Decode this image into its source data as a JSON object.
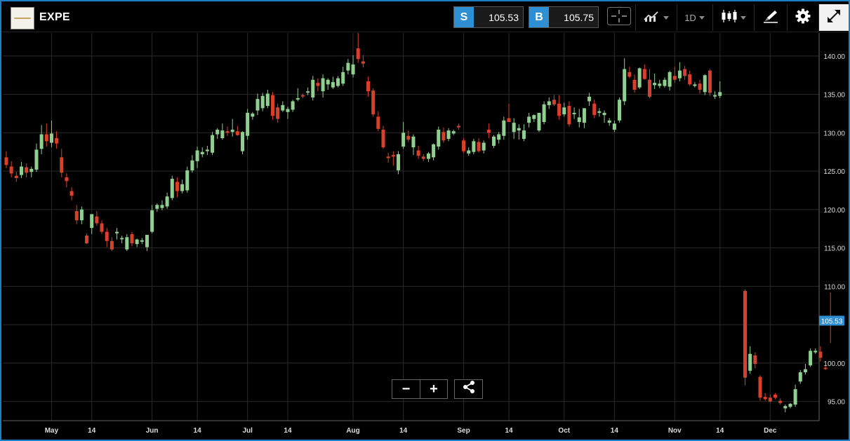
{
  "header": {
    "symbol": "EXPE",
    "sell_tag": "S",
    "sell_price": "105.53",
    "buy_tag": "B",
    "buy_price": "105.75",
    "timeframe": "1D"
  },
  "icons": [
    "logo-icon",
    "crosshair-icon",
    "indicators-icon",
    "candlestick-icon",
    "drawing-icon",
    "gear-icon",
    "fullscreen-icon",
    "zoom-out-icon",
    "zoom-in-icon",
    "share-icon"
  ],
  "colors": {
    "up": "#8fcf8f",
    "down": "#d9402b",
    "accent": "#2e8fd3",
    "grid": "#2a2a2a"
  },
  "chart_data": {
    "type": "candlestick",
    "ylim": [
      92.5,
      143
    ],
    "y_ticks": [
      95,
      100,
      105,
      110,
      115,
      120,
      125,
      130,
      135,
      140
    ],
    "y_tick_labels": [
      "95.00",
      "100.00",
      "",
      "110.00",
      "115.00",
      "120.00",
      "125.00",
      "130.00",
      "135.00",
      "140.00"
    ],
    "x_ticks": [
      {
        "label": "May",
        "index": 9
      },
      {
        "label": "14",
        "index": 17
      },
      {
        "label": "Jun",
        "index": 29
      },
      {
        "label": "14",
        "index": 38
      },
      {
        "label": "Jul",
        "index": 48
      },
      {
        "label": "14",
        "index": 56
      },
      {
        "label": "Aug",
        "index": 69
      },
      {
        "label": "14",
        "index": 79
      },
      {
        "label": "Sep",
        "index": 91
      },
      {
        "label": "14",
        "index": 100
      },
      {
        "label": "Oct",
        "index": 111
      },
      {
        "label": "14",
        "index": 121
      },
      {
        "label": "Nov",
        "index": 133
      },
      {
        "label": "14",
        "index": 142
      },
      {
        "label": "Dec",
        "index": 152
      }
    ],
    "last_price": 105.53,
    "last_price_label": "105.53",
    "ohlc": [
      [
        126.8,
        127.6,
        125.4,
        125.8
      ],
      [
        125.6,
        126.3,
        124.2,
        124.7
      ],
      [
        124.4,
        124.9,
        123.6,
        124.1
      ],
      [
        124.5,
        126.2,
        124.1,
        125.6
      ],
      [
        125.5,
        126.0,
        124.2,
        124.8
      ],
      [
        124.9,
        125.6,
        124.2,
        125.3
      ],
      [
        125.2,
        128.6,
        124.9,
        127.8
      ],
      [
        127.9,
        131.0,
        127.2,
        129.8
      ],
      [
        129.8,
        131.2,
        128.2,
        128.9
      ],
      [
        128.7,
        131.6,
        128.1,
        129.9
      ],
      [
        129.3,
        130.2,
        127.9,
        128.6
      ],
      [
        126.8,
        127.9,
        124.2,
        124.8
      ],
      [
        124.2,
        124.7,
        122.9,
        123.7
      ],
      [
        122.4,
        122.9,
        121.2,
        121.8
      ],
      [
        119.8,
        120.6,
        118.1,
        118.6
      ],
      [
        118.6,
        120.4,
        118.1,
        120.0
      ],
      [
        116.6,
        116.9,
        115.5,
        115.6
      ],
      [
        117.6,
        119.3,
        116.8,
        119.4
      ],
      [
        119.1,
        119.8,
        117.9,
        118.2
      ],
      [
        118.2,
        118.6,
        116.8,
        117.1
      ],
      [
        117.1,
        117.6,
        115.1,
        115.9
      ],
      [
        115.9,
        116.4,
        114.6,
        114.8
      ],
      [
        116.9,
        117.6,
        116.1,
        117.1
      ],
      [
        116.2,
        116.6,
        115.6,
        116.3
      ],
      [
        114.8,
        116.8,
        114.6,
        116.4
      ],
      [
        116.8,
        117.1,
        115.2,
        115.6
      ],
      [
        115.5,
        116.2,
        115.1,
        116.1
      ],
      [
        115.8,
        116.3,
        115.5,
        116.0
      ],
      [
        115.1,
        116.4,
        114.6,
        116.7
      ],
      [
        117.1,
        120.6,
        116.9,
        119.9
      ],
      [
        120.1,
        120.8,
        119.7,
        120.6
      ],
      [
        120.2,
        121.2,
        119.9,
        120.6
      ],
      [
        120.4,
        122.2,
        120.1,
        121.7
      ],
      [
        121.5,
        124.4,
        121.2,
        124.0
      ],
      [
        123.6,
        124.2,
        121.6,
        122.4
      ],
      [
        122.4,
        123.9,
        122.1,
        123.3
      ],
      [
        122.5,
        125.6,
        122.2,
        125.1
      ],
      [
        125.1,
        127.1,
        124.8,
        126.4
      ],
      [
        126.3,
        128.2,
        125.4,
        127.7
      ],
      [
        127.2,
        128.1,
        126.8,
        127.5
      ],
      [
        127.6,
        128.3,
        127.1,
        127.8
      ],
      [
        127.4,
        130.1,
        127.1,
        129.7
      ],
      [
        129.8,
        130.6,
        129.2,
        130.4
      ],
      [
        129.3,
        131.2,
        129.1,
        130.3
      ],
      [
        130.2,
        130.8,
        129.6,
        130.0
      ],
      [
        130.1,
        131.8,
        129.5,
        130.4
      ],
      [
        130.2,
        130.9,
        129.6,
        129.7
      ],
      [
        127.6,
        130.2,
        127.2,
        130.1
      ],
      [
        129.6,
        133.1,
        129.1,
        132.6
      ],
      [
        132.1,
        132.7,
        131.7,
        132.5
      ],
      [
        132.9,
        135.1,
        132.3,
        134.4
      ],
      [
        133.2,
        135.2,
        132.8,
        134.8
      ],
      [
        133.5,
        135.6,
        133.2,
        135.1
      ],
      [
        134.9,
        135.3,
        131.7,
        132.2
      ],
      [
        133.3,
        133.8,
        131.3,
        131.8
      ],
      [
        132.9,
        134.1,
        132.7,
        133.6
      ],
      [
        132.7,
        133.4,
        131.8,
        133.1
      ],
      [
        133.0,
        134.3,
        132.7,
        134.1
      ],
      [
        134.4,
        135.8,
        134.1,
        134.5
      ],
      [
        134.9,
        135.1,
        134.5,
        134.8
      ],
      [
        135.4,
        135.9,
        134.9,
        135.4
      ],
      [
        134.6,
        137.4,
        134.2,
        136.9
      ],
      [
        136.5,
        137.1,
        135.4,
        136.1
      ],
      [
        135.4,
        137.6,
        134.6,
        137.1
      ],
      [
        136.3,
        137.1,
        135.6,
        136.9
      ],
      [
        135.9,
        137.3,
        135.7,
        136.6
      ],
      [
        136.1,
        137.4,
        135.9,
        137.1
      ],
      [
        136.4,
        138.6,
        136.1,
        137.9
      ],
      [
        138.1,
        139.6,
        137.6,
        139.1
      ],
      [
        137.6,
        140.1,
        137.2,
        138.9
      ],
      [
        141.0,
        143.0,
        139.1,
        139.6
      ],
      [
        139.3,
        140.1,
        138.5,
        139.0
      ],
      [
        136.7,
        137.3,
        134.7,
        135.4
      ],
      [
        135.5,
        135.8,
        132.1,
        132.4
      ],
      [
        132.1,
        132.8,
        130.2,
        130.5
      ],
      [
        130.4,
        130.9,
        127.9,
        128.1
      ],
      [
        126.9,
        127.4,
        126.1,
        126.7
      ],
      [
        127.1,
        127.6,
        125.7,
        126.9
      ],
      [
        125.1,
        127.6,
        124.6,
        127.2
      ],
      [
        128.2,
        131.4,
        127.9,
        130.0
      ],
      [
        129.6,
        130.3,
        128.8,
        129.1
      ],
      [
        128.1,
        129.8,
        127.1,
        129.5
      ],
      [
        127.7,
        128.3,
        126.6,
        127.0
      ],
      [
        126.9,
        127.2,
        126.3,
        126.6
      ],
      [
        126.6,
        127.5,
        126.2,
        127.3
      ],
      [
        126.8,
        128.6,
        126.4,
        128.5
      ],
      [
        128.2,
        130.8,
        127.8,
        130.4
      ],
      [
        130.1,
        130.7,
        128.7,
        129.0
      ],
      [
        129.2,
        130.6,
        128.9,
        130.3
      ],
      [
        129.9,
        130.4,
        129.7,
        130.2
      ],
      [
        130.9,
        131.2,
        130.4,
        130.7
      ],
      [
        129.0,
        129.3,
        127.4,
        127.6
      ],
      [
        127.3,
        128.1,
        127.0,
        127.7
      ],
      [
        127.5,
        129.2,
        127.2,
        128.9
      ],
      [
        128.8,
        129.3,
        127.4,
        127.6
      ],
      [
        127.7,
        129.0,
        127.3,
        128.7
      ],
      [
        130.4,
        131.2,
        129.3,
        130.0
      ],
      [
        128.3,
        129.7,
        128.0,
        129.5
      ],
      [
        129.1,
        130.1,
        128.6,
        129.8
      ],
      [
        129.6,
        132.1,
        129.1,
        131.6
      ],
      [
        131.9,
        133.8,
        131.5,
        131.4
      ],
      [
        130.1,
        131.9,
        129.2,
        131.3
      ],
      [
        130.3,
        131.1,
        129.1,
        130.6
      ],
      [
        129.2,
        131.1,
        128.9,
        130.3
      ],
      [
        131.3,
        132.6,
        130.7,
        132.1
      ],
      [
        131.8,
        132.4,
        131.4,
        132.3
      ],
      [
        130.3,
        132.4,
        130.1,
        132.6
      ],
      [
        131.4,
        134.1,
        131.1,
        133.7
      ],
      [
        133.6,
        134.6,
        133.1,
        134.1
      ],
      [
        134.3,
        134.9,
        133.5,
        133.7
      ],
      [
        133.8,
        134.9,
        131.7,
        132.2
      ],
      [
        132.4,
        133.9,
        132.1,
        133.3
      ],
      [
        133.5,
        134.1,
        130.8,
        131.1
      ],
      [
        132.5,
        133.3,
        131.8,
        132.6
      ],
      [
        131.4,
        133.1,
        130.7,
        132.0
      ],
      [
        131.3,
        132.3,
        130.6,
        133.2
      ],
      [
        134.1,
        135.2,
        133.5,
        134.7
      ],
      [
        133.8,
        134.3,
        131.9,
        132.3
      ],
      [
        132.6,
        133.2,
        132.1,
        132.8
      ],
      [
        132.3,
        132.9,
        131.3,
        132.6
      ],
      [
        131.3,
        131.9,
        130.9,
        131.6
      ],
      [
        130.4,
        131.6,
        130.1,
        131.2
      ],
      [
        131.6,
        134.6,
        131.3,
        134.3
      ],
      [
        134.1,
        139.7,
        133.6,
        138.3
      ],
      [
        137.9,
        138.6,
        137.1,
        137.3
      ],
      [
        136.9,
        137.6,
        135.2,
        135.6
      ],
      [
        135.9,
        138.5,
        135.7,
        138.4
      ],
      [
        138.3,
        138.9,
        136.9,
        137.0
      ],
      [
        136.9,
        138.3,
        134.5,
        134.7
      ],
      [
        136.2,
        137.7,
        135.7,
        136.5
      ],
      [
        136.1,
        136.9,
        135.8,
        136.4
      ],
      [
        136.1,
        137.2,
        135.9,
        136.9
      ],
      [
        136.0,
        138.1,
        135.5,
        137.9
      ],
      [
        137.4,
        138.6,
        136.5,
        136.9
      ],
      [
        137.1,
        139.2,
        136.7,
        138.1
      ],
      [
        138.3,
        138.7,
        136.9,
        137.4
      ],
      [
        137.6,
        138.1,
        136.1,
        136.3
      ],
      [
        136.1,
        136.6,
        135.9,
        136.3
      ],
      [
        136.4,
        136.9,
        135.1,
        135.6
      ],
      [
        135.3,
        137.6,
        134.9,
        137.5
      ],
      [
        138.1,
        138.3,
        134.8,
        135.2
      ],
      [
        134.8,
        135.4,
        134.4,
        134.9
      ],
      [
        134.8,
        136.7,
        134.5,
        135.3
      ],
      [
        null,
        null,
        null,
        null
      ],
      [
        null,
        null,
        null,
        null
      ],
      [
        null,
        null,
        null,
        null
      ],
      [
        null,
        null,
        null,
        null
      ],
      [
        109.4,
        109.6,
        97.1,
        98.1
      ],
      [
        99.0,
        102.2,
        98.6,
        101.2
      ],
      [
        101.0,
        101.4,
        99.3,
        99.9
      ],
      [
        98.2,
        98.4,
        95.1,
        95.5
      ],
      [
        95.6,
        96.1,
        95.1,
        95.3
      ],
      [
        95.5,
        95.9,
        94.9,
        95.0
      ],
      [
        95.9,
        96.1,
        95.3,
        95.5
      ],
      [
        95.1,
        95.4,
        94.6,
        94.8
      ],
      [
        94.1,
        94.6,
        93.6,
        94.4
      ],
      [
        94.3,
        94.8,
        94.1,
        94.7
      ],
      [
        94.6,
        97.2,
        94.3,
        96.6
      ],
      [
        97.6,
        99.1,
        97.3,
        98.8
      ],
      [
        98.8,
        99.9,
        98.5,
        99.2
      ],
      [
        99.7,
        101.9,
        99.5,
        101.6
      ],
      [
        101.4,
        101.9,
        101.2,
        101.6
      ],
      [
        101.5,
        102.2,
        100.2,
        100.7
      ],
      [
        99.4,
        99.7,
        99.1,
        99.3
      ],
      [
        106.0,
        109.2,
        102.6,
        105.6
      ]
    ]
  }
}
